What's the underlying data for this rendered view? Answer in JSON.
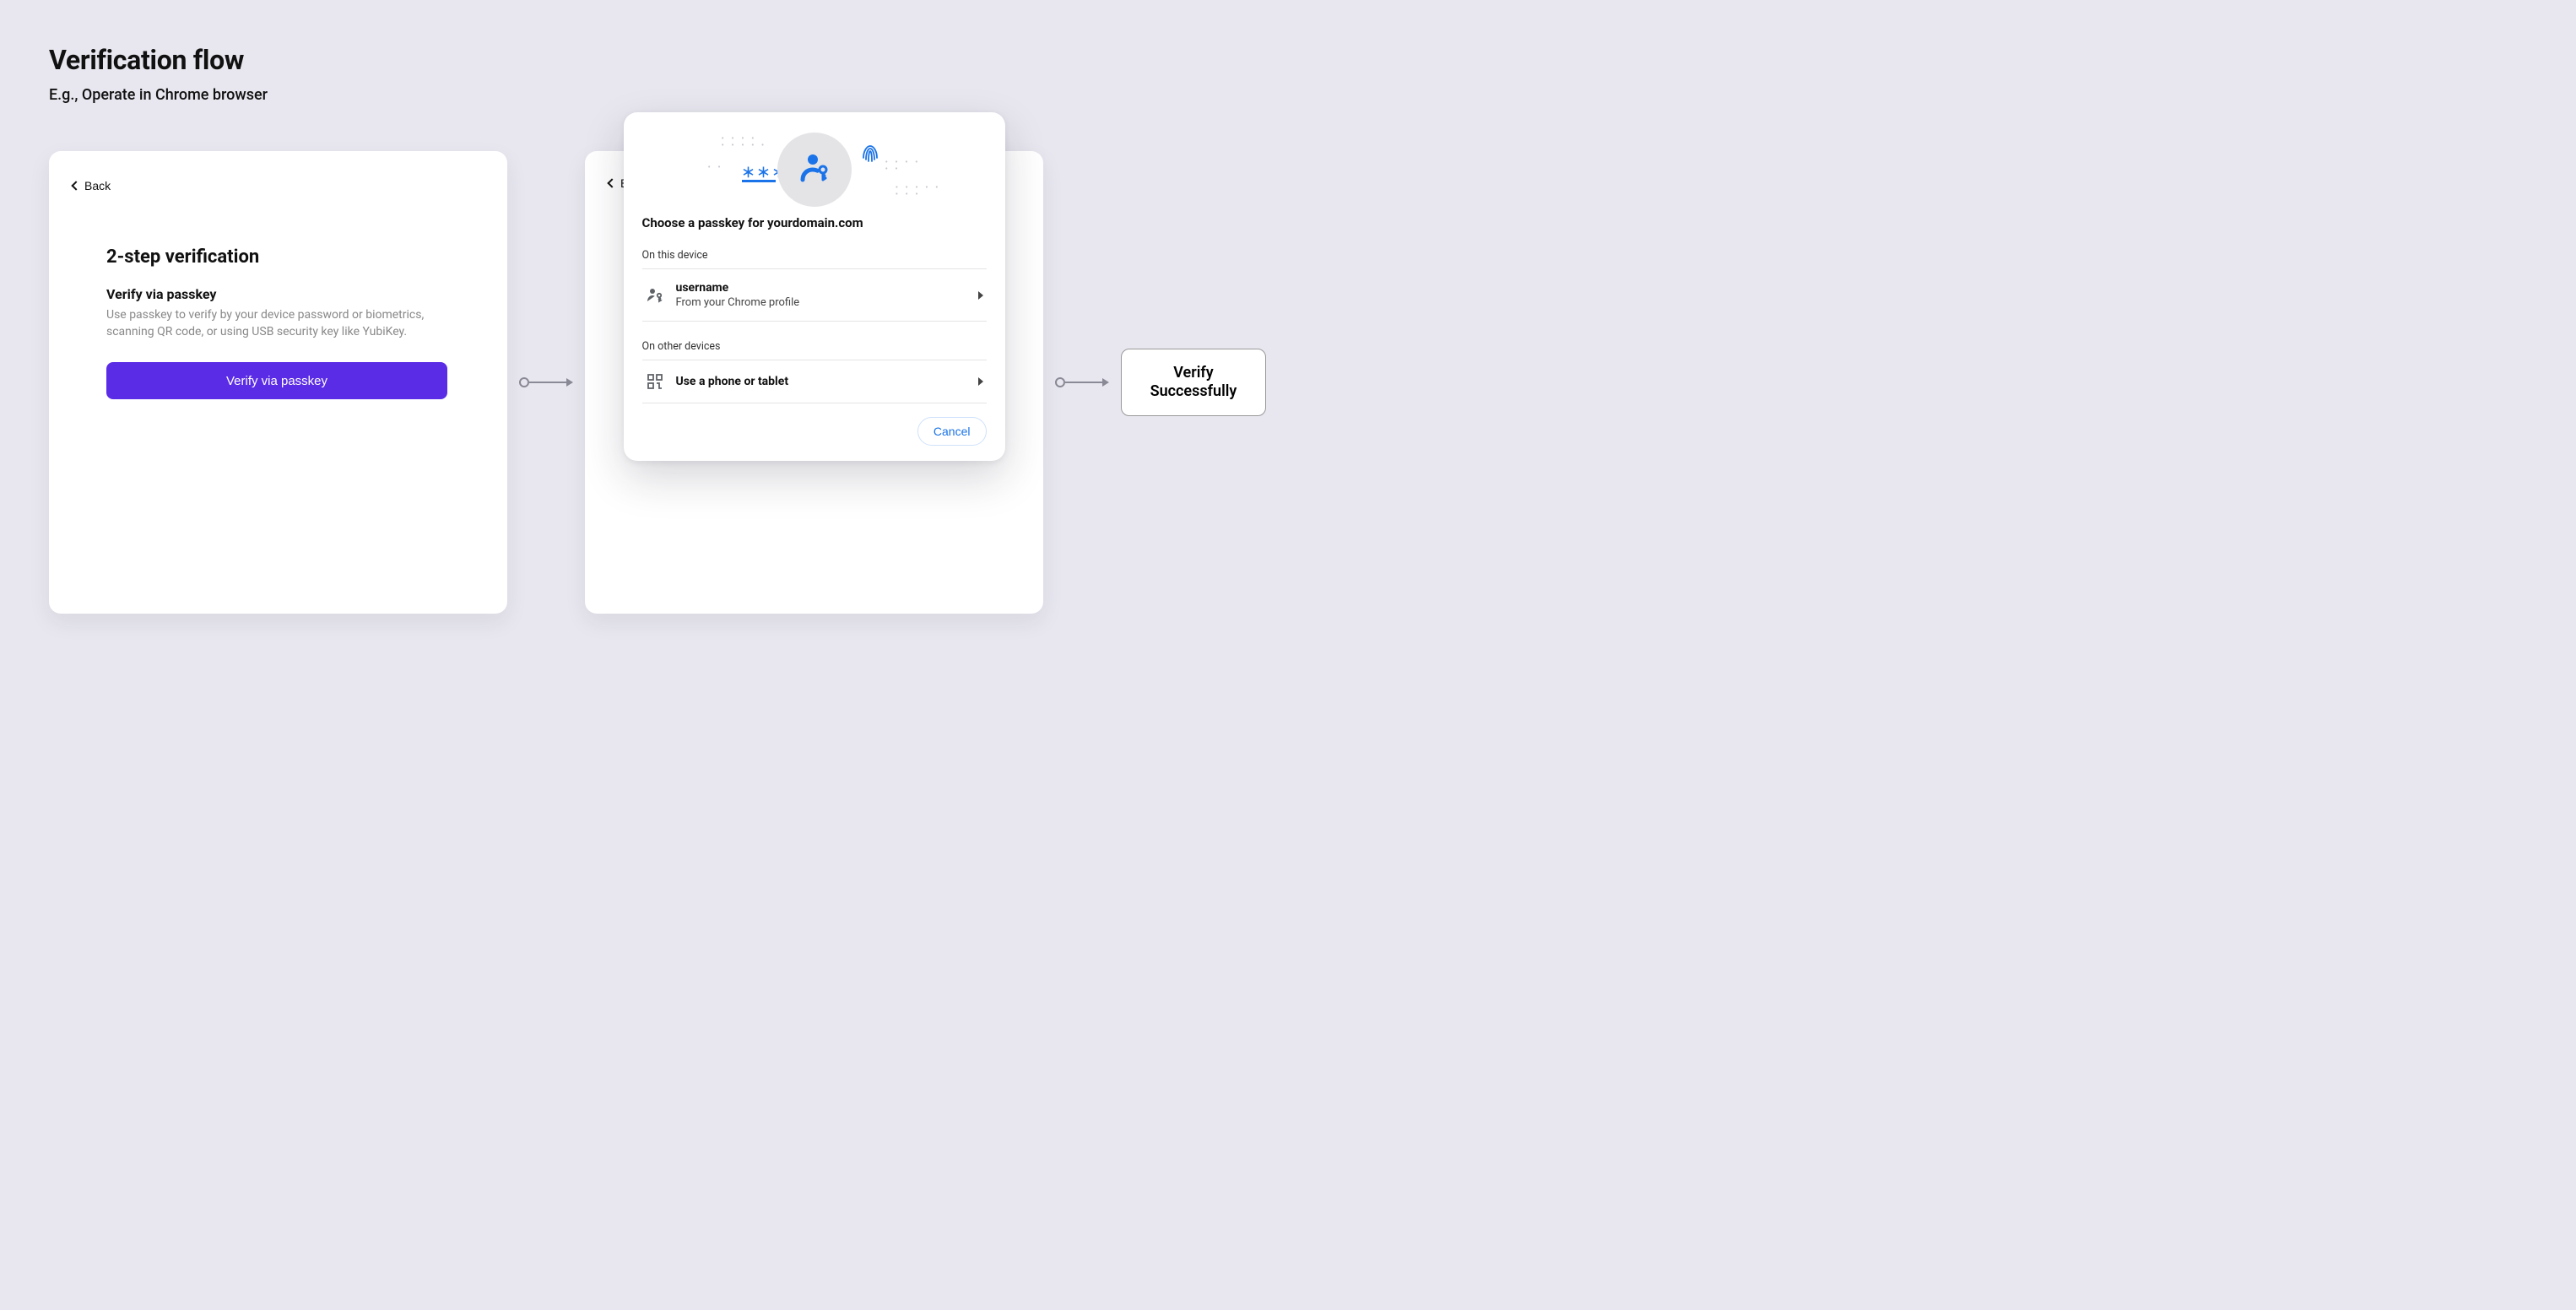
{
  "header": {
    "title": "Verification flow",
    "subtitle": "E.g., Operate in Chrome browser"
  },
  "step1": {
    "back_label": "Back",
    "heading": "2-step verification",
    "subheading": "Verify via passkey",
    "description": "Use passkey to verify by your device password or biometrics, scanning QR code, or using USB security key like YubiKey.",
    "button_label": "Verify via passkey"
  },
  "step2": {
    "back_label": "Back",
    "dialog": {
      "title_prefix": "Choose a passkey for",
      "domain": "yourdomain.com",
      "sections": {
        "this_device_label": "On this device",
        "other_devices_label": "On other devices"
      },
      "this_device": {
        "username": "username",
        "source": "From your Chrome profile"
      },
      "other_devices": {
        "label": "Use a phone or tablet"
      },
      "cancel_label": "Cancel"
    }
  },
  "result": {
    "line1": "Verify",
    "line2": "Successfully"
  },
  "colors": {
    "accent": "#5B2CE6",
    "link": "#1A73E8",
    "bg": "#E8E7EF"
  }
}
